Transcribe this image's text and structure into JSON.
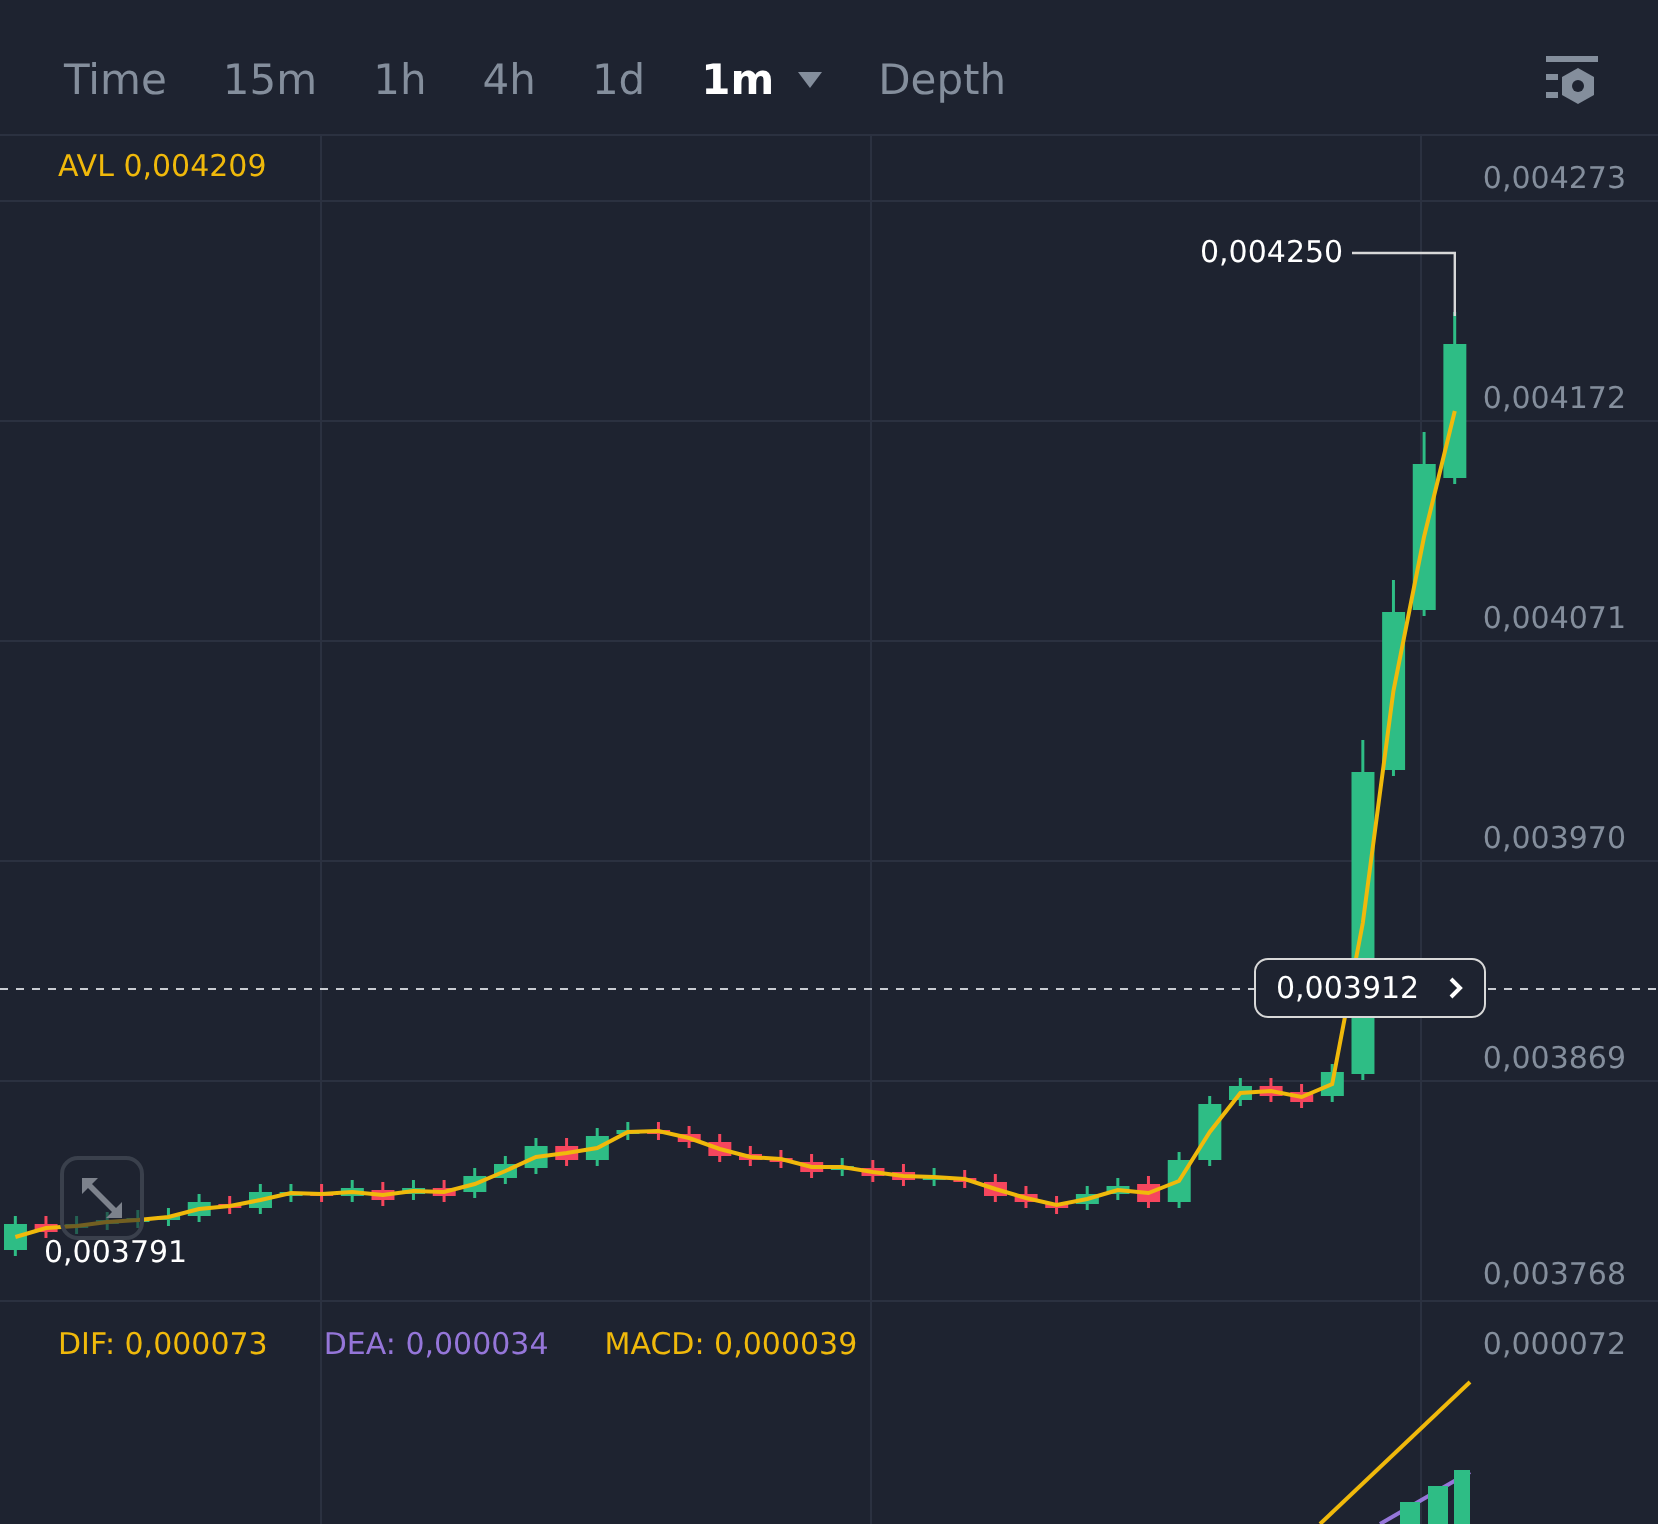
{
  "toolbar": {
    "tabs": [
      {
        "label": "Time",
        "selected": false,
        "dropdown": false
      },
      {
        "label": "15m",
        "selected": false,
        "dropdown": false
      },
      {
        "label": "1h",
        "selected": false,
        "dropdown": false
      },
      {
        "label": "4h",
        "selected": false,
        "dropdown": false
      },
      {
        "label": "1d",
        "selected": false,
        "dropdown": false
      },
      {
        "label": "1m",
        "selected": true,
        "dropdown": true
      },
      {
        "label": "Depth",
        "selected": false,
        "dropdown": false
      }
    ]
  },
  "chart": {
    "indicator": "AVL 0,004209",
    "price_axis": [
      "0,004273",
      "0,004172",
      "0,004071",
      "0,003970",
      "0,003869",
      "0,003768"
    ],
    "high_label": "0,004250",
    "low_label": "0,003791",
    "current_price": "0,003912"
  },
  "macd": {
    "dif": "DIF: 0,000073",
    "dea": "DEA: 0,000034",
    "macd": "MACD: 0,000039",
    "axis_label": "0,000072"
  }
}
